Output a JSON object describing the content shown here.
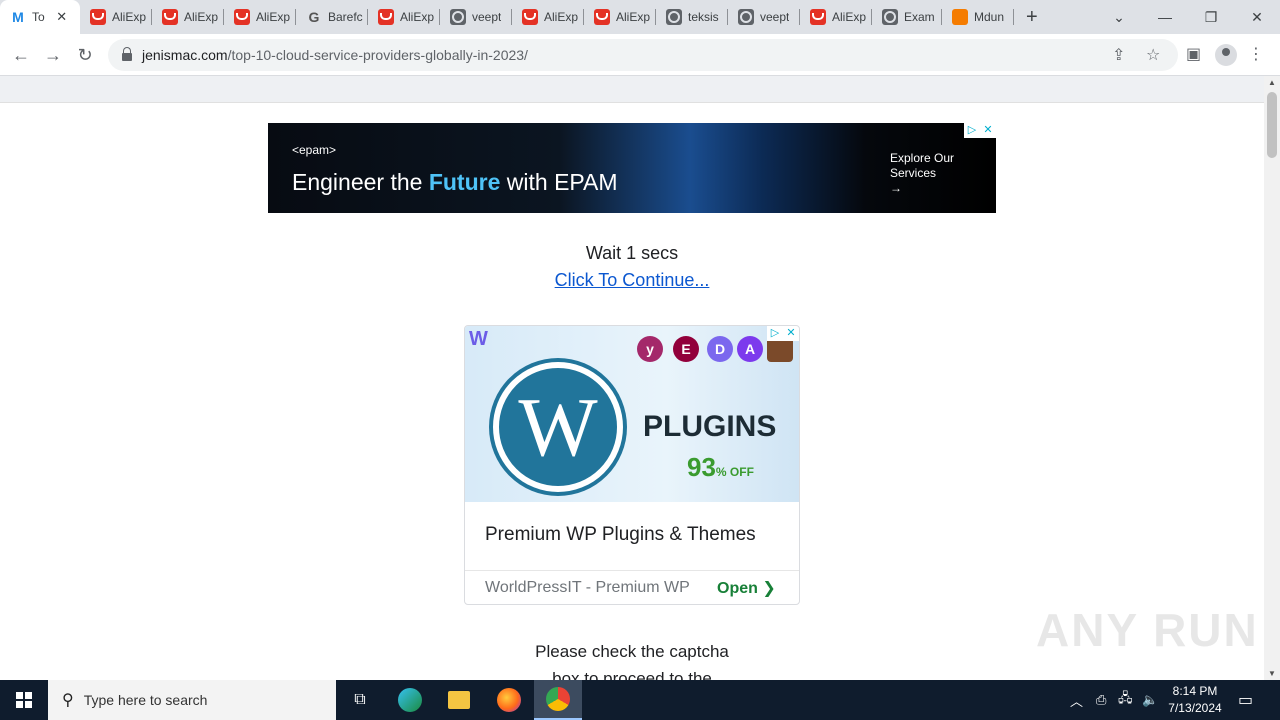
{
  "browser": {
    "tabs": [
      {
        "title": "To",
        "favicon": "m-icon",
        "active": true
      },
      {
        "title": "AliExp",
        "favicon": "aliexpress-icon"
      },
      {
        "title": "AliExp",
        "favicon": "aliexpress-icon"
      },
      {
        "title": "AliExp",
        "favicon": "aliexpress-icon"
      },
      {
        "title": "Barefc",
        "favicon": "g-icon"
      },
      {
        "title": "AliExp",
        "favicon": "aliexpress-icon"
      },
      {
        "title": "veept",
        "favicon": "globe-icon"
      },
      {
        "title": "AliExp",
        "favicon": "aliexpress-icon"
      },
      {
        "title": "AliExp",
        "favicon": "aliexpress-icon"
      },
      {
        "title": "teksis",
        "favicon": "globe-icon"
      },
      {
        "title": "veept",
        "favicon": "globe-icon"
      },
      {
        "title": "AliExp",
        "favicon": "aliexpress-icon"
      },
      {
        "title": "Exam",
        "favicon": "globe-icon"
      },
      {
        "title": "Mdun",
        "favicon": "mdun-icon"
      }
    ],
    "url_domain": "jenismac.com",
    "url_path": "/top-10-cloud-service-providers-globally-in-2023/"
  },
  "page": {
    "banner_ad": {
      "brand": "<epam>",
      "headline_pre": "Engineer the ",
      "headline_highlight": "Future",
      "headline_post": " with EPAM",
      "cta_line1": "Explore Our",
      "cta_line2": "Services",
      "cta_arrow": "→"
    },
    "wait_text": "Wait 1 secs",
    "continue_link": "Click To Continue...",
    "wp_ad": {
      "image_text": "PLUGINS",
      "discount_number": "93",
      "discount_suffix": "% OFF",
      "title": "Premium WP Plugins & Themes",
      "source": "WorldPressIT - Premium WP",
      "open_label": "Open"
    },
    "captcha_line1": "Please check the captcha",
    "captcha_line2": "box to proceed to the",
    "watermark": "ANY RUN"
  },
  "taskbar": {
    "search_placeholder": "Type here to search",
    "time": "8:14 PM",
    "date": "7/13/2024"
  }
}
